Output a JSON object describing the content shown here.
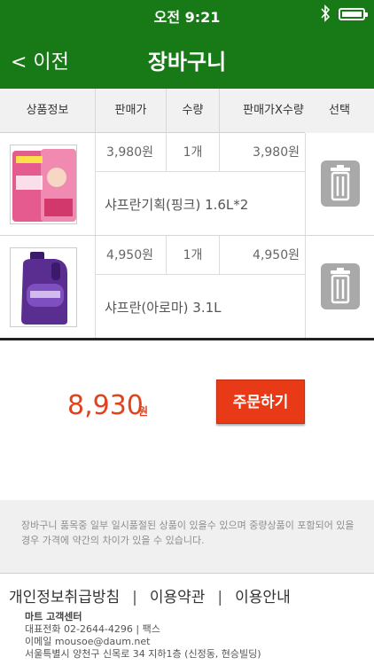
{
  "status_bar": {
    "time": "오전 9:21",
    "bluetooth_icon": "bluetooth-icon",
    "battery_icon": "battery-icon"
  },
  "nav": {
    "back_label": "< 이전",
    "title": "장바구니"
  },
  "table_header": {
    "product_info": "상품정보",
    "price": "판매가",
    "quantity": "수량",
    "price_x_qty": "판매가X수량",
    "select": "선택"
  },
  "items": [
    {
      "price": "3,980원",
      "quantity": "1개",
      "total": "3,980원",
      "name": "샤프란기획(핑크) 1.6L*2",
      "delete_icon": "trash-icon"
    },
    {
      "price": "4,950원",
      "quantity": "1개",
      "total": "4,950원",
      "name": "샤프란(아로마) 3.1L",
      "delete_icon": "trash-icon"
    }
  ],
  "order": {
    "total_amount": "8,930",
    "currency": "원",
    "order_button": "주문하기"
  },
  "notice": {
    "text": "장바구니 품목중 일부 일시품절된 상품이 있을수 있으며 중량상품이 포함되어 있을 경우 가격에 약간의 차이가 있을 수 있습니다."
  },
  "footer": {
    "links": [
      "개인정보취급방침",
      "이용약관",
      "이용안내"
    ],
    "separator": "|",
    "customer_center": "마트 고객센터",
    "phone": "대표전화 02-2644-4296 | 팩스",
    "email": "이메일 mousoe@daum.net",
    "address": "서울특별시 양천구 신목로 34 지하1층 (신정동, 현승빌딩)"
  },
  "colors": {
    "header_green": "#177a17",
    "accent_red": "#e1431f",
    "button_red": "#e83a16"
  }
}
